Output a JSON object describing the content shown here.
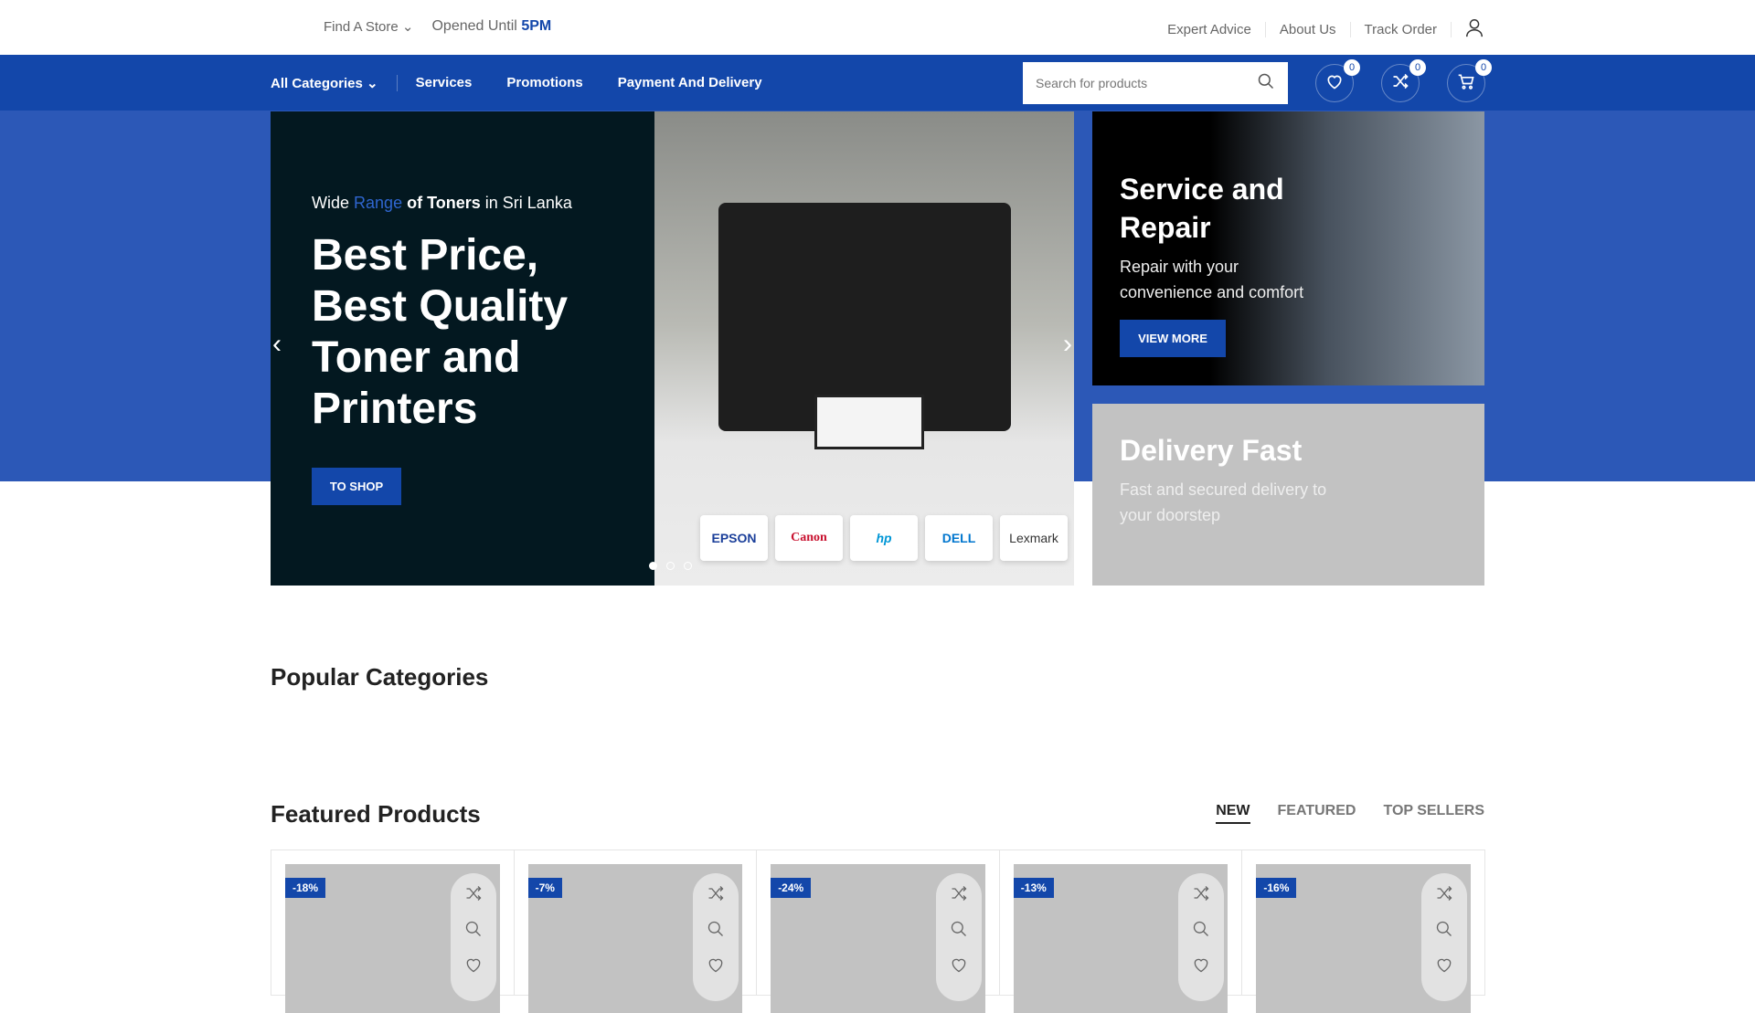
{
  "topbar": {
    "find_store": "Find A Store",
    "opened_prefix": "Opened Until",
    "opened_time": "5PM",
    "links": [
      "Expert Advice",
      "About Us",
      "Track Order"
    ]
  },
  "nav": {
    "items": [
      "All Categories",
      "Services",
      "Promotions",
      "Payment And Delivery"
    ],
    "search_placeholder": "Search for products",
    "wishlist_count": "0",
    "compare_count": "0",
    "cart_count": "0"
  },
  "hero": {
    "sub_1": "Wide",
    "sub_2": "Range",
    "sub_3": "of Toners",
    "sub_4": "in Sri Lanka",
    "headline": "Best Price, Best Quality Toner and Printers",
    "button": "TO SHOP",
    "brands": [
      "EPSON",
      "Canon",
      "hp",
      "DELL",
      "Lexmark"
    ]
  },
  "service": {
    "title": "Service and Repair",
    "text": "Repair with your convenience and comfort",
    "button": "VIEW MORE"
  },
  "delivery": {
    "title": "Delivery Fast",
    "text": "Fast and secured delivery to your doorstep"
  },
  "popular": {
    "title": "Popular Categories"
  },
  "featured": {
    "title": "Featured Products",
    "tabs": [
      "NEW",
      "FEATURED",
      "TOP SELLERS"
    ],
    "products": [
      {
        "discount": "-18%"
      },
      {
        "discount": "-7%"
      },
      {
        "discount": "-24%"
      },
      {
        "discount": "-13%"
      },
      {
        "discount": "-16%"
      }
    ]
  },
  "colors": {
    "brand": "#1347aa",
    "dark": "#031820"
  }
}
